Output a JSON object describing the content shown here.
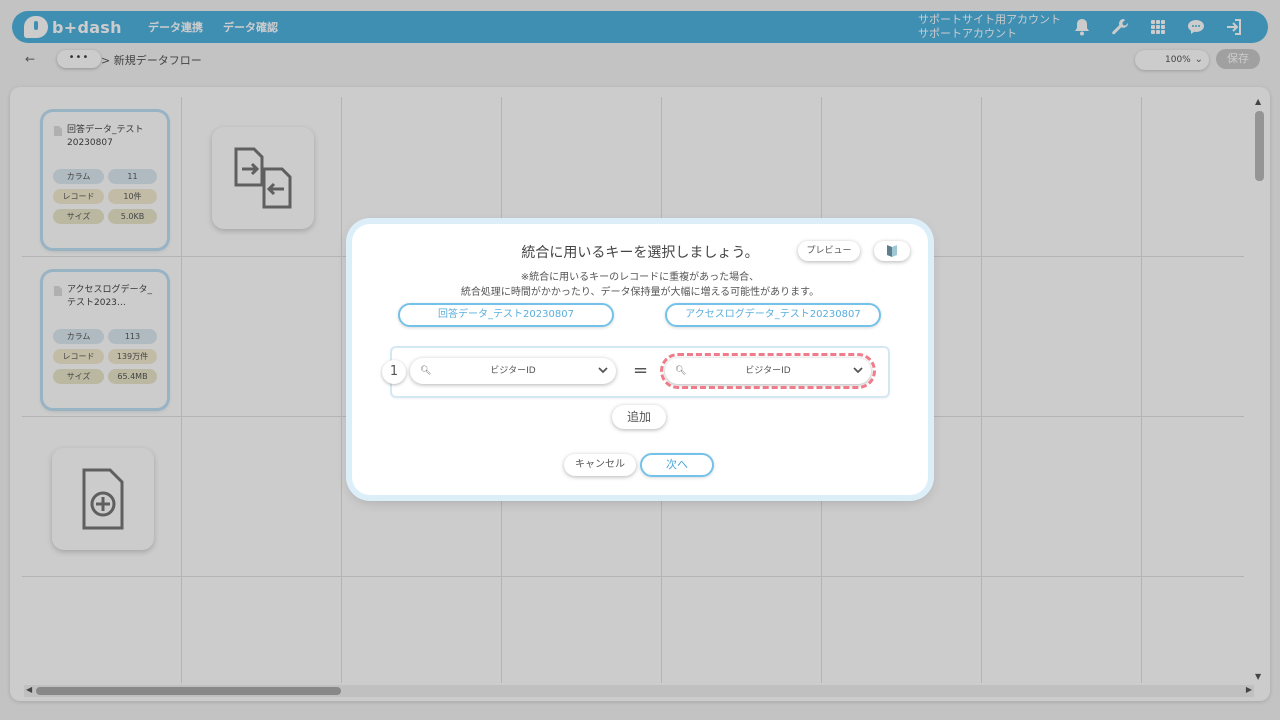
{
  "header": {
    "logo_text": "b+dash",
    "nav": [
      "データ連携",
      "データ確認"
    ],
    "account_line1": "サポートサイト用アカウント",
    "account_line2": "サポートアカウント",
    "icons": [
      "bell-icon",
      "wrench-icon",
      "apps-grid-icon",
      "chat-icon",
      "logout-icon"
    ]
  },
  "subbar": {
    "back_glyph": "←",
    "more_glyph": "•••",
    "breadcrumb": "> 新規データフロー",
    "zoom": "100%",
    "save_label": "保存"
  },
  "canvas": {
    "nodes": [
      {
        "name": "回答データ_テスト20230807",
        "stats": [
          {
            "label": "カラム",
            "value": "11"
          },
          {
            "label": "レコード",
            "value": "10件"
          },
          {
            "label": "サイズ",
            "value": "5.0KB"
          }
        ]
      },
      {
        "name": "アクセスログデータ_テスト2023…",
        "stats": [
          {
            "label": "カラム",
            "value": "113"
          },
          {
            "label": "レコード",
            "value": "139万件"
          },
          {
            "label": "サイズ",
            "value": "65.4MB"
          }
        ]
      }
    ]
  },
  "modal": {
    "title": "統合に用いるキーを選択しましょう。",
    "preview_label": "プレビュー",
    "notice_line1": "※統合に用いるキーのレコードに重複があった場合、",
    "notice_line2": "統合処理に時間がかかったり、データ保持量が大幅に増える可能性があります。",
    "source_left": "回答データ_テスト20230807",
    "source_right": "アクセスログデータ_テスト20230807",
    "keys": [
      {
        "index": "1",
        "left": "ビジターID",
        "right": "ビジターID"
      }
    ],
    "equals": "=",
    "add_label": "追加",
    "cancel_label": "キャンセル",
    "next_label": "次へ"
  }
}
